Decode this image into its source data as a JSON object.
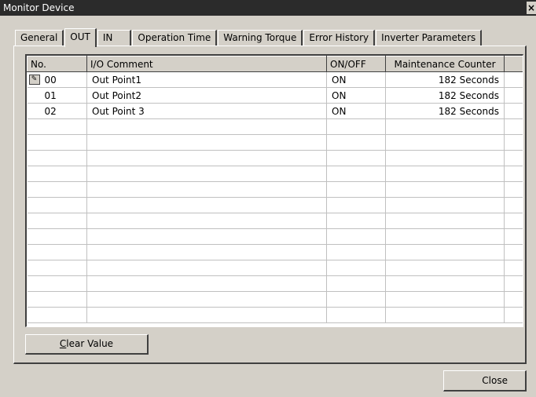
{
  "window": {
    "title": "Monitor Device",
    "close_glyph": "×"
  },
  "tabs": [
    {
      "label": "General"
    },
    {
      "label": "OUT",
      "active": true
    },
    {
      "label": "IN"
    },
    {
      "label": "Operation Time"
    },
    {
      "label": "Warning Torque"
    },
    {
      "label": "Error History"
    },
    {
      "label": "Inverter Parameters"
    }
  ],
  "grid": {
    "columns": [
      "No.",
      "I/O Comment",
      "ON/OFF",
      "Maintenance Counter"
    ],
    "rows": [
      {
        "no": "00",
        "comment": "Out Point1",
        "state": "ON",
        "counter": "182 Seconds",
        "icon": "edit-icon"
      },
      {
        "no": "01",
        "comment": "Out Point2",
        "state": "ON",
        "counter": "182 Seconds"
      },
      {
        "no": "02",
        "comment": "Out Point 3",
        "state": "ON",
        "counter": "182 Seconds"
      }
    ],
    "empty_rows": 13
  },
  "buttons": {
    "clear_mnemonic": "C",
    "clear_rest": "lear Value",
    "close": "Close"
  }
}
